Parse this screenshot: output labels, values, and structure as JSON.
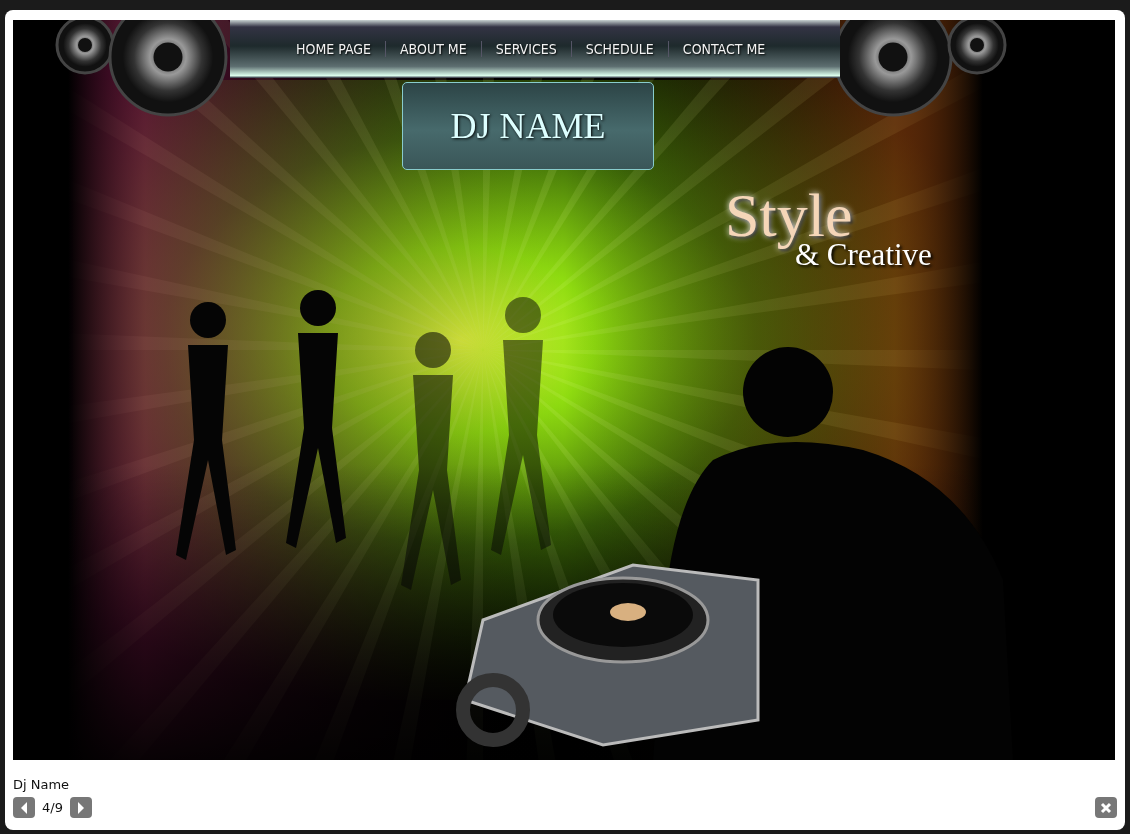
{
  "artwork": {
    "nav_items": [
      "HOME PAGE",
      "ABOUT ME",
      "SERVICES",
      "SCHEDULE",
      "CONTACT ME"
    ],
    "logo": "DJ NAME",
    "slogan_main": "Style",
    "slogan_sub": "& Creative"
  },
  "caption": "Dj Name",
  "counter": "4/9"
}
